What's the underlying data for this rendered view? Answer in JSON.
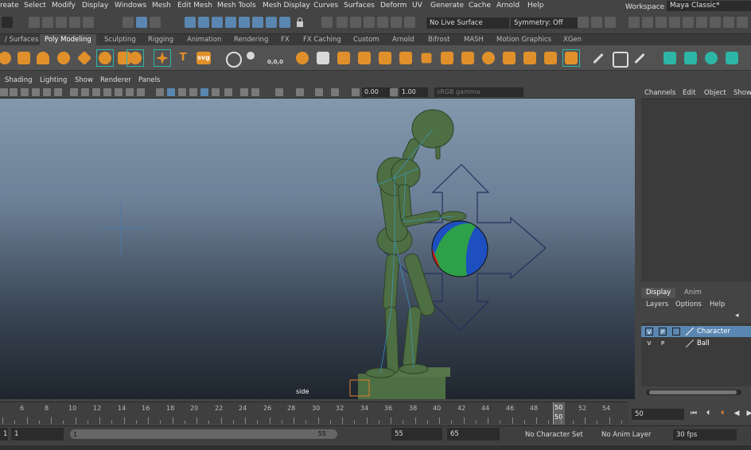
{
  "menubar": {
    "items": [
      "reate",
      "Select",
      "Modify",
      "Display",
      "Windows",
      "Mesh",
      "Edit Mesh",
      "Mesh Tools",
      "Mesh Display",
      "Curves",
      "Surfaces",
      "Deform",
      "UV",
      "Generate",
      "Cache",
      "Arnold",
      "Help"
    ],
    "workspace_label": "Workspace :",
    "workspace_value": "Maya Classic*"
  },
  "statusline": {
    "live_surface": "No Live Surface",
    "symmetry": "Symmetry: Off"
  },
  "shelf_tabs": [
    "/ Surfaces",
    "Poly Modeling",
    "Sculpting",
    "Rigging",
    "Animation",
    "Rendering",
    "FX",
    "FX Caching",
    "Custom",
    "Arnold",
    "Bifrost",
    "MASH",
    "Motion Graphics",
    "XGen"
  ],
  "shelf_active": "Poly Modeling",
  "shelf": {
    "text_icon": "T",
    "svg_icon": "svg",
    "coord_label": "0,0,0"
  },
  "viewport_menu": [
    "Shading",
    "Lighting",
    "Show",
    "Renderer",
    "Panels"
  ],
  "viewport_toolbar": {
    "exposure": "0.00",
    "gamma": "1.00",
    "colorspace": "sRGB gamma"
  },
  "viewport": {
    "camera_label": "side"
  },
  "channel_box_menu": [
    "Channels",
    "Edit",
    "Object",
    "Show"
  ],
  "layer_tabs": [
    "Display",
    "Anim"
  ],
  "layer_active_tab": "Display",
  "layer_menu": [
    "Layers",
    "Options",
    "Help"
  ],
  "layers": [
    {
      "v": "V",
      "p": "P",
      "name": "Character",
      "selected": true
    },
    {
      "v": "V",
      "p": "P",
      "name": "Ball",
      "selected": false
    }
  ],
  "timeline": {
    "ticks": [
      "6",
      "8",
      "10",
      "12",
      "14",
      "16",
      "18",
      "20",
      "22",
      "24",
      "26",
      "28",
      "30",
      "32",
      "34",
      "36",
      "38",
      "40",
      "42",
      "44",
      "46",
      "48",
      "50",
      "52",
      "54"
    ],
    "playhead_top": "50",
    "playhead_bottom": "50",
    "current_frame": "50"
  },
  "range": {
    "start": "1",
    "anim_start": "1",
    "slider_start": "1",
    "slider_end": "55",
    "playback_end": "55",
    "anim_end": "65",
    "character_set": "No Character Set",
    "anim_layer": "No Anim Layer",
    "fps": "30 fps"
  },
  "colors": {
    "accent": "#5a87b1",
    "shelf_orange": "#e0902b",
    "character_green": "#4e6e43",
    "ball_red": "#d02020",
    "ball_green": "#2ea04a",
    "ball_blue": "#1d4fc0"
  }
}
